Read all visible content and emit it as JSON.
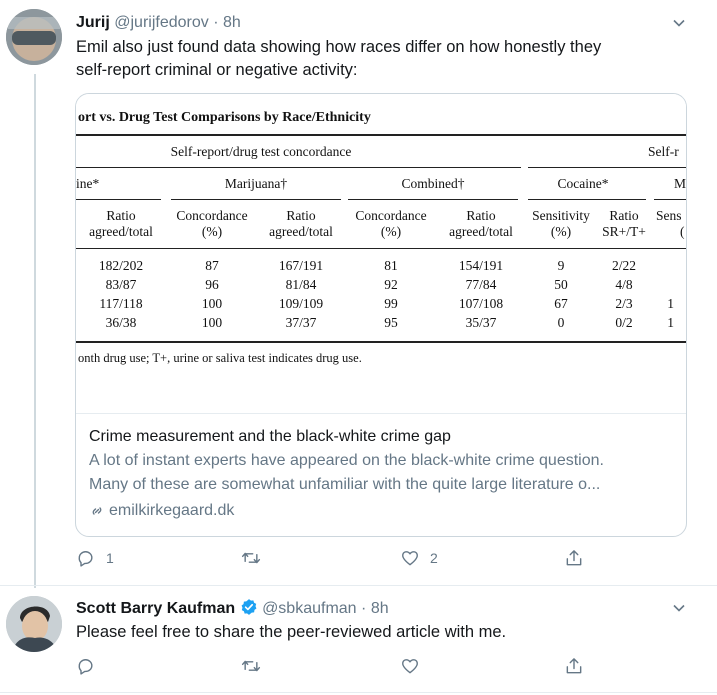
{
  "tweet1": {
    "name": "Jurij",
    "handle": "@jurijfedorov",
    "time": "8h",
    "text_line1": "Emil also just found data showing how races differ on how honestly they",
    "text_line2": "self-report criminal or negative activity:",
    "card": {
      "image_table": {
        "title": "ort vs. Drug Test Comparisons by Race/Ethnicity",
        "group1": "Self-report/drug test concordance",
        "group2": "Self-r",
        "subgroups": [
          "ine*",
          "Marijuana†",
          "Combined†",
          "Cocaine*",
          "M"
        ],
        "col_headers": [
          [
            "Ratio",
            "agreed/total"
          ],
          [
            "Concordance",
            "(%)"
          ],
          [
            "Ratio",
            "agreed/total"
          ],
          [
            "Concordance",
            "(%)"
          ],
          [
            "Ratio",
            "agreed/total"
          ],
          [
            "Sensitivity",
            "(%)"
          ],
          [
            "Ratio",
            "SR+/T+"
          ],
          [
            "Sens",
            "("
          ]
        ],
        "rows": [
          [
            "182/202",
            "87",
            "167/191",
            "81",
            "154/191",
            "9",
            "2/22",
            ""
          ],
          [
            "83/87",
            "96",
            "81/84",
            "92",
            "77/84",
            "50",
            "4/8",
            ""
          ],
          [
            "117/118",
            "100",
            "109/109",
            "99",
            "107/108",
            "67",
            "2/3",
            "1"
          ],
          [
            "36/38",
            "100",
            "37/37",
            "95",
            "35/37",
            "0",
            "0/2",
            "1"
          ]
        ],
        "footnote": "onth drug use; T+, urine or saliva test indicates drug use."
      },
      "title": "Crime measurement and the black-white crime gap",
      "desc_line1": "A lot of instant experts have appeared on the black-white crime question.",
      "desc_line2": "Many of these are somewhat unfamiliar with the quite large literature o...",
      "domain": "emilkirkegaard.dk"
    },
    "actions": {
      "replies": "1",
      "retweets": "",
      "likes": "2"
    }
  },
  "tweet2": {
    "name": "Scott Barry Kaufman",
    "handle": "@sbkaufman",
    "time": "8h",
    "text": "Please feel free to share the peer-reviewed article with me.",
    "actions": {
      "replies": "",
      "retweets": "",
      "likes": ""
    }
  },
  "colors": {
    "secondary": "#657786",
    "verified": "#1da1f2",
    "border": "#ccd6dd"
  },
  "separator": "·"
}
